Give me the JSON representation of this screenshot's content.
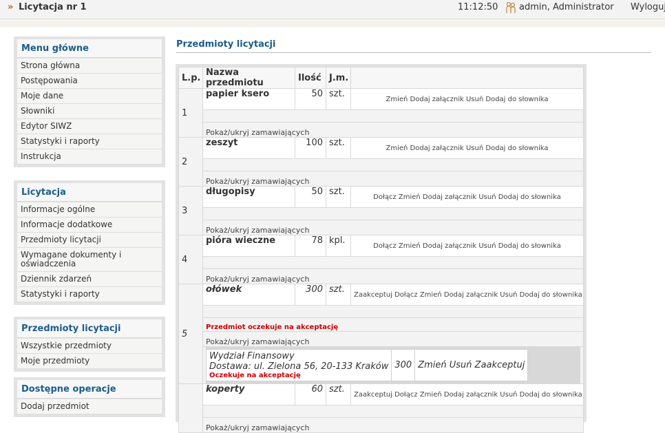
{
  "header": {
    "marker": "»",
    "title": "Licytacja nr 1",
    "time": "11:12:50",
    "user": "admin, Administrator",
    "logout": "Wyloguj"
  },
  "menus": [
    {
      "title": "Menu główne",
      "items": [
        "Strona główna",
        "Postępowania",
        "Moje dane",
        "Słowniki",
        "Edytor SIWZ",
        "Statystyki i raporty",
        "Instrukcja"
      ]
    },
    {
      "title": "Licytacja",
      "items": [
        "Informacje ogólne",
        "Informacje dodatkowe",
        "Przedmioty licytacji",
        "Wymagane dokumenty i oświadczenia",
        "Dziennik zdarzeń",
        "Statystyki i raporty"
      ]
    },
    {
      "title": "Przedmioty licytacji",
      "items": [
        "Wszystkie przedmioty",
        "Moje przedmioty"
      ]
    },
    {
      "title": "Dostępne operacje",
      "items": [
        "Dodaj przedmiot"
      ]
    }
  ],
  "section_title": "Przedmioty licytacji",
  "table": {
    "headers": [
      "L.p.",
      "Nazwa przedmiotu",
      "Ilość",
      "J.m.",
      ""
    ],
    "toggle_label": "Pokaż/ukryj zamawiających",
    "pending_label": "Przedmiot oczekuje na akceptację",
    "rows": [
      {
        "lp": "1",
        "name": "papier ksero",
        "qty": "50",
        "unit": "szt.",
        "actions": "Zmień Dodaj załącznik Usuń Dodaj do słownika",
        "italic": false,
        "pending": false
      },
      {
        "lp": "2",
        "name": "zeszyt",
        "qty": "100",
        "unit": "szt.",
        "actions": "Zmień Dodaj załącznik Usuń Dodaj do słownika",
        "italic": false,
        "pending": false
      },
      {
        "lp": "3",
        "name": "długopisy",
        "qty": "50",
        "unit": "szt.",
        "actions": "Dołącz Zmień Dodaj załącznik Usuń Dodaj do słownika",
        "italic": false,
        "pending": false
      },
      {
        "lp": "4",
        "name": "pióra wieczne",
        "qty": "78",
        "unit": "kpl.",
        "actions": "Dołącz Zmień Dodaj załącznik Usuń Dodaj do słownika",
        "italic": false,
        "pending": false
      },
      {
        "lp": "5",
        "name": "ołówek",
        "qty": "300",
        "unit": "szt.",
        "actions": "Zaakceptuj Dołącz Zmień Dodaj załącznik Usuń Dodaj do słownika",
        "italic": true,
        "pending": true,
        "sub": {
          "dept": "Wydział Finansowy",
          "delivery": "Dostawa: ul. Zielona 56, 20-133 Kraków",
          "status": "Oczekuje na akceptację",
          "qty": "300",
          "actions": "Zmień Usuń Zaakceptuj"
        }
      },
      {
        "lp": "",
        "name": "koperty",
        "qty": "60",
        "unit": "szt.",
        "actions": "Zaakceptuj Dołącz Zmień Dodaj załącznik Usuń Dodaj do słownika",
        "italic": true,
        "pending": false
      }
    ]
  },
  "colors": {
    "accent": "#1b5c8a",
    "pending": "#cc0000",
    "menu_frame": "#e2e2e2"
  }
}
